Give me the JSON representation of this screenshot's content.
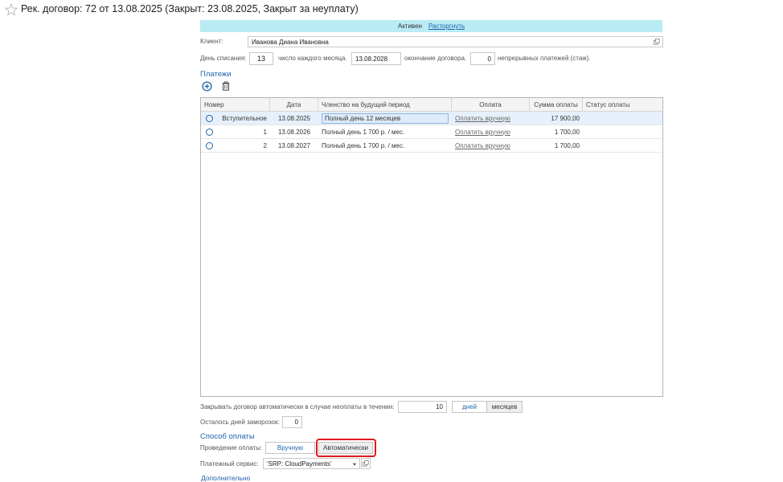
{
  "window": {
    "title": "Рек. договор: 72 от 13.08.2025 (Закрыт: 23.08.2025, Закрыт за неуплату)"
  },
  "status_bar": {
    "status": "Активен",
    "action_link": "Расторгнуть"
  },
  "client": {
    "label": "Клиент:",
    "value": "Иванова Диана Ивановна"
  },
  "billing": {
    "day_label": "День списания:",
    "day_value": "13",
    "each_month_label": "число каждого месяца.",
    "end_date_value": "13.08.2028",
    "end_label": "окончание договора.",
    "continuous_value": "0",
    "continuous_label": "непрерывных платежей (стаж)."
  },
  "payments": {
    "heading": "Платежи",
    "columns": [
      "Номер",
      "Дата",
      "Членство на будущий период",
      "Оплата",
      "Сумма оплаты",
      "Статус оплаты"
    ],
    "rows": [
      {
        "number": "Вступительное",
        "date": "13.08.2025",
        "period": "Полный день 12 месяцев",
        "pay": "Оплатить вручную",
        "sum": "17 900,00",
        "status": ""
      },
      {
        "number": "1",
        "date": "13.08.2026",
        "period": "Полный день 1 700 р. / мес.",
        "pay": "Оплатить вручную",
        "sum": "1 700,00",
        "status": ""
      },
      {
        "number": "2",
        "date": "13.08.2027",
        "period": "Полный день 1 700 р. / мес.",
        "pay": "Оплатить вручную",
        "sum": "1 700,00",
        "status": ""
      }
    ]
  },
  "auto_close": {
    "label": "Закрывать договор автоматически в случае неоплаты в течении:",
    "value": "10",
    "days_button": "дней",
    "months_button": "месяцев"
  },
  "freeze": {
    "label": "Осталось дней заморозок:",
    "value": "0"
  },
  "payment_method": {
    "heading": "Способ оплаты",
    "label": "Проведение оплаты:",
    "manual_button": "Вручную",
    "auto_button": "Автоматически",
    "service_label": "Платежный сервис:",
    "service_value": "'SRP: CloudPayments'"
  },
  "more_link": "Дополнительно",
  "colors": {
    "accent": "#1c63ad",
    "status_bar": "#b9ebf4",
    "highlight_outline": "#e0191b"
  },
  "icons": [
    "star-icon",
    "open-icon",
    "add-icon",
    "delete-icon",
    "dropdown-icon"
  ]
}
